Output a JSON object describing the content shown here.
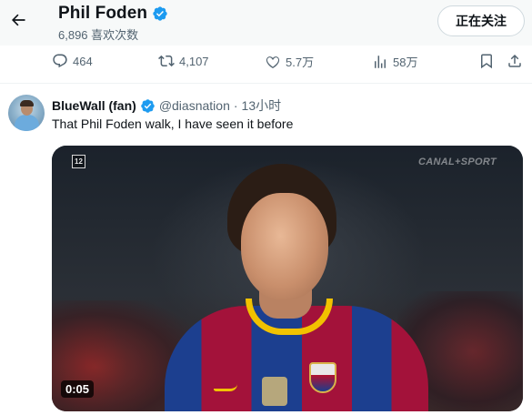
{
  "header": {
    "back_icon": "arrow-left-icon",
    "title": "Phil Foden",
    "verified_icon": "verified-badge-icon",
    "subtitle": "6,896 喜欢次数",
    "follow_button": "正在关注"
  },
  "actions": {
    "reply": {
      "icon": "reply-icon",
      "count": "464"
    },
    "repost": {
      "icon": "repost-icon",
      "count": "4,107"
    },
    "like": {
      "icon": "heart-icon",
      "count": "5.7万"
    },
    "views": {
      "icon": "views-chart-icon",
      "count": "58万"
    },
    "bookmark": {
      "icon": "bookmark-icon"
    },
    "share": {
      "icon": "share-icon"
    }
  },
  "tweet": {
    "display_name": "BlueWall (fan)",
    "handle": "@diasnation",
    "separator": "·",
    "time": "13小时",
    "text": "That Phil Foden walk, I have seen it before",
    "video": {
      "rating_badge": "12",
      "channel_watermark": "CANAL+SPORT",
      "duration": "0:05"
    }
  },
  "colors": {
    "accent": "#1d9bf0",
    "text_primary": "#0f1419",
    "text_secondary": "#536471",
    "header_bg": "#f7f9f9"
  }
}
